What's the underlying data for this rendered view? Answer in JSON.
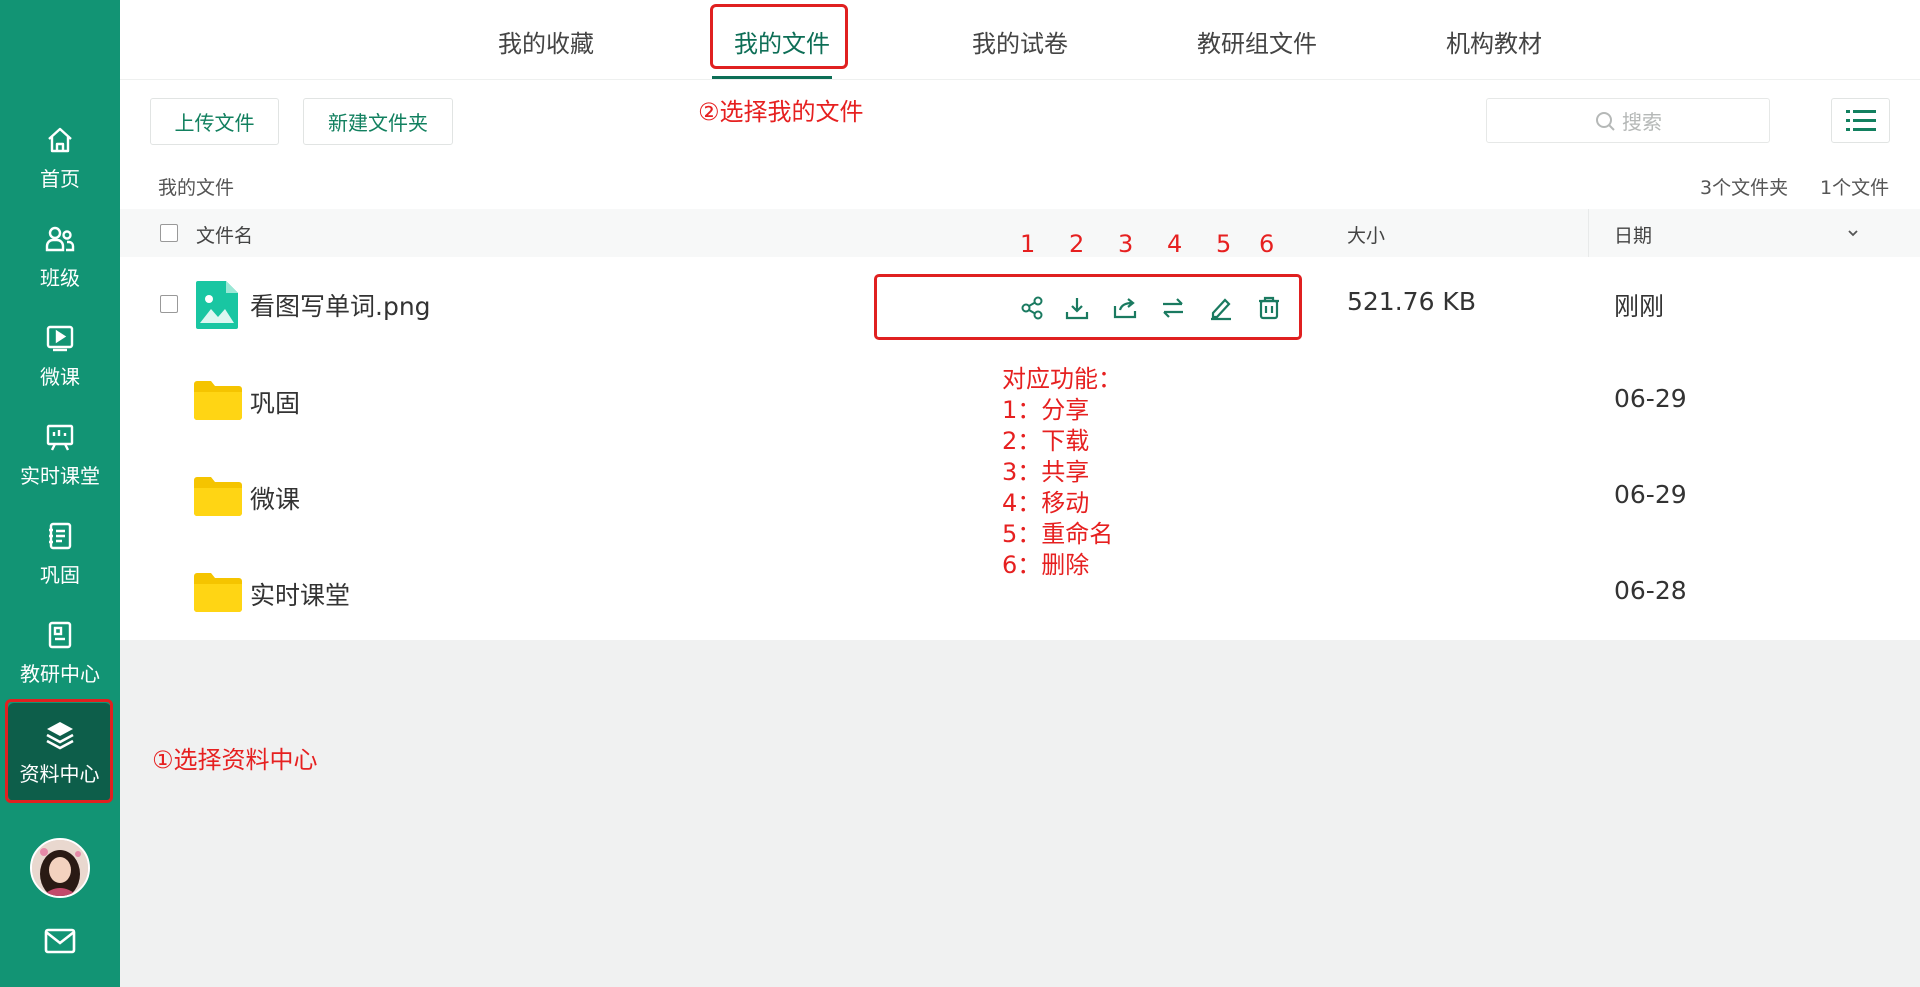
{
  "sidebar": {
    "items": [
      {
        "label": "首页",
        "icon": "home-icon"
      },
      {
        "label": "班级",
        "icon": "users-icon"
      },
      {
        "label": "微课",
        "icon": "video-icon"
      },
      {
        "label": "实时课堂",
        "icon": "classroom-icon"
      },
      {
        "label": "巩固",
        "icon": "notebook-icon"
      },
      {
        "label": "教研中心",
        "icon": "book-icon"
      },
      {
        "label": "资料中心",
        "icon": "layers-icon"
      }
    ],
    "active": "资料中心"
  },
  "tabs": [
    "我的收藏",
    "我的文件",
    "我的试卷",
    "教研组文件",
    "机构教材"
  ],
  "active_tab": "我的文件",
  "toolbar": {
    "upload_label": "上传文件",
    "new_folder_label": "新建文件夹",
    "search_placeholder": "搜索"
  },
  "breadcrumb": "我的文件",
  "counts": {
    "folders": "3个文件夹",
    "files": "1个文件"
  },
  "table": {
    "col_name": "文件名",
    "col_size": "大小",
    "col_date": "日期",
    "rows": [
      {
        "type": "image-file",
        "name": "看图写单词.png",
        "size": "521.76 KB",
        "date": "刚刚"
      },
      {
        "type": "folder",
        "name": "巩固",
        "size": "",
        "date": "06-29"
      },
      {
        "type": "folder",
        "name": "微课",
        "size": "",
        "date": "06-29"
      },
      {
        "type": "folder",
        "name": "实时课堂",
        "size": "",
        "date": "06-28"
      }
    ]
  },
  "row_actions": [
    "share-icon",
    "download-icon",
    "forward-icon",
    "move-icon",
    "rename-icon",
    "delete-icon"
  ],
  "annotations": {
    "numbers": [
      "1",
      "2",
      "3",
      "4",
      "5",
      "6"
    ],
    "step1": "①选择资料中心",
    "step2": "②选择我的文件",
    "legend": [
      "对应功能：",
      "1：分享",
      "2：下载",
      "3：共享",
      "4：移动",
      "5：重命名",
      "6：删除"
    ]
  },
  "colors": {
    "sidebar": "#129474",
    "accent": "#0d6e56",
    "annotation": "#e62020"
  }
}
